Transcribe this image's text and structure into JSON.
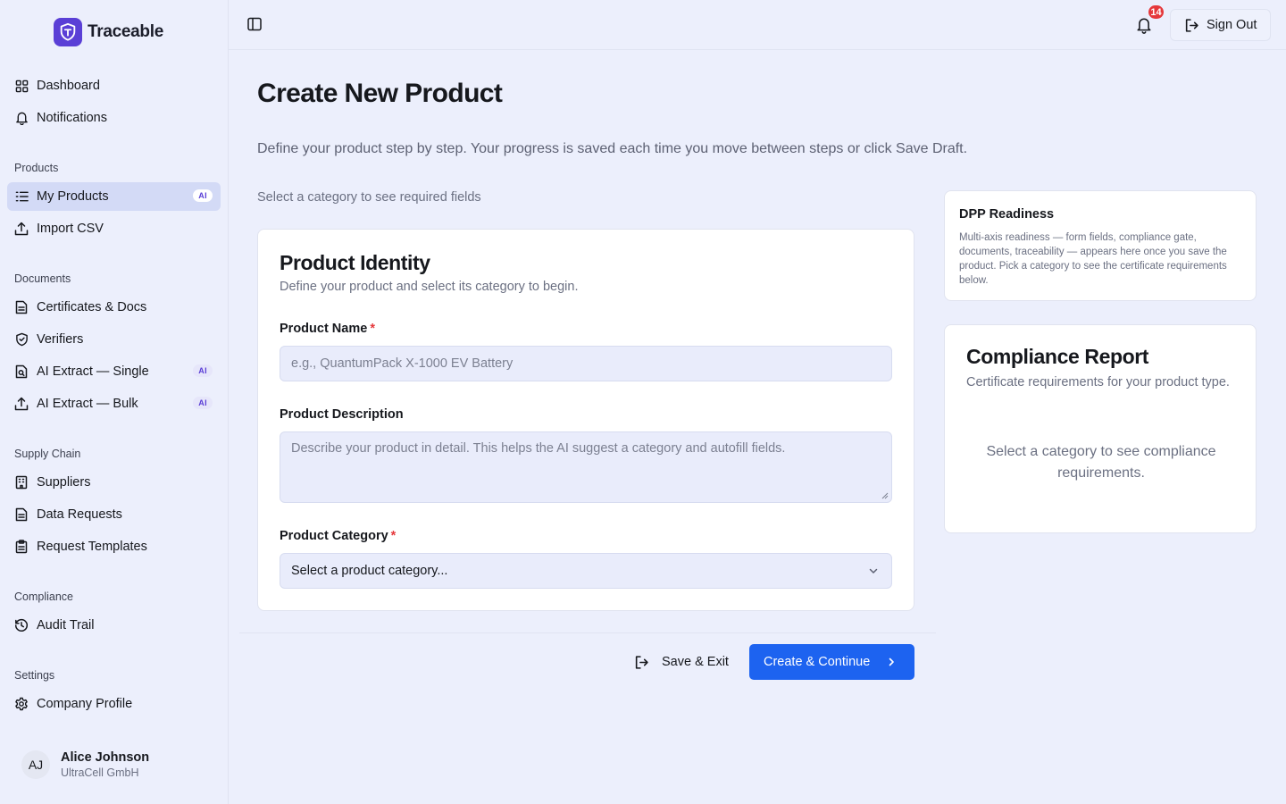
{
  "app": {
    "name": "Traceable"
  },
  "sidebar": {
    "top_items": [
      {
        "label": "Dashboard",
        "icon": "grid-icon"
      },
      {
        "label": "Notifications",
        "icon": "bell-icon"
      }
    ],
    "sections": {
      "products": {
        "title": "Products",
        "items": [
          {
            "label": "My Products",
            "icon": "list-icon",
            "badge": "AI",
            "active": true
          },
          {
            "label": "Import CSV",
            "icon": "upload-icon"
          }
        ]
      },
      "documents": {
        "title": "Documents",
        "items": [
          {
            "label": "Certificates & Docs",
            "icon": "document-icon"
          },
          {
            "label": "Verifiers",
            "icon": "shield-check-icon"
          },
          {
            "label": "AI Extract — Single",
            "icon": "file-scan-icon",
            "badge": "AI"
          },
          {
            "label": "AI Extract — Bulk",
            "icon": "upload-icon",
            "badge": "AI"
          }
        ]
      },
      "supply_chain": {
        "title": "Supply Chain",
        "items": [
          {
            "label": "Suppliers",
            "icon": "building-icon"
          },
          {
            "label": "Data Requests",
            "icon": "document-icon"
          },
          {
            "label": "Request Templates",
            "icon": "clipboard-icon"
          }
        ]
      },
      "compliance": {
        "title": "Compliance",
        "items": [
          {
            "label": "Audit Trail",
            "icon": "history-icon"
          }
        ]
      },
      "settings": {
        "title": "Settings",
        "items": [
          {
            "label": "Company Profile",
            "icon": "gear-icon"
          }
        ]
      }
    },
    "user": {
      "initials": "AJ",
      "name": "Alice Johnson",
      "company": "UltraCell GmbH"
    }
  },
  "topbar": {
    "notification_count": "14",
    "sign_out_label": "Sign Out"
  },
  "main": {
    "title": "Create New Product",
    "description": "Define your product step by step. Your progress is saved each time you move between steps or click Save Draft.",
    "category_hint": "Select a category to see required fields",
    "card": {
      "title": "Product Identity",
      "subtitle": "Define your product and select its category to begin.",
      "name_label": "Product Name",
      "name_placeholder": "e.g., QuantumPack X-1000 EV Battery",
      "description_label": "Product Description",
      "description_placeholder": "Describe your product in detail. This helps the AI suggest a category and autofill fields.",
      "category_label": "Product Category",
      "category_value": "Select a product category...",
      "required_mark": "*"
    },
    "actions": {
      "save_exit": "Save & Exit",
      "create_continue": "Create & Continue"
    }
  },
  "right_panel": {
    "dpp": {
      "title": "DPP Readiness",
      "text": "Multi-axis readiness — form fields, compliance gate, documents, traceability — appears here once you save the product. Pick a category to see the certificate requirements below."
    },
    "compliance": {
      "title": "Compliance Report",
      "subtitle": "Certificate requirements for your product type.",
      "empty": "Select a category to see compliance requirements."
    }
  },
  "colors": {
    "brand": "#5a3fd6",
    "primary_button": "#1d63f0",
    "badge_red": "#e5383b",
    "background": "#eceffc"
  }
}
